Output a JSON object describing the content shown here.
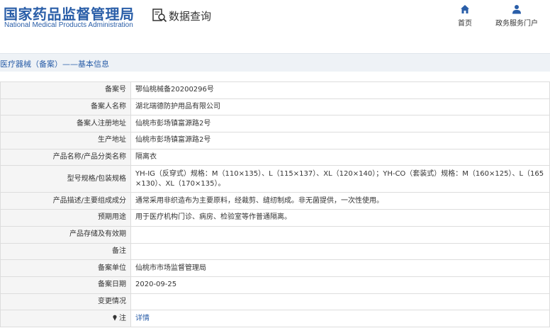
{
  "header": {
    "logo_cn": "国家药品监督管理局",
    "logo_en": "National Medical Products Administration",
    "page_title": "数据查询",
    "nav": [
      {
        "label": "首页",
        "icon": "home-icon"
      },
      {
        "label": "政务服务门户",
        "icon": "user-icon"
      }
    ]
  },
  "section": {
    "title": "医疗器械（备案）——基本信息"
  },
  "rows": [
    {
      "label": "备案号",
      "value": "鄂仙桃械备20200296号"
    },
    {
      "label": "备案人名称",
      "value": "湖北瑞德防护用品有限公司"
    },
    {
      "label": "备案人注册地址",
      "value": "仙桃市彭场镇富源路2号"
    },
    {
      "label": "生产地址",
      "value": "仙桃市彭场镇富源路2号"
    },
    {
      "label": "产品名称/产品分类名称",
      "value": "隔离衣"
    },
    {
      "label": "型号规格/包装规格",
      "value": "YH-IG（反穿式）规格：M（110×135）、L（115×137）、XL（120×140）；YH-CO（套装式）规格：M（160×125）、L（165×130）、XL（170×135）。"
    },
    {
      "label": "产品描述/主要组成成分",
      "value": "通常采用非织造布为主要原料，经裁剪、缝纫制成。非无菌提供，一次性使用。"
    },
    {
      "label": "预期用途",
      "value": "用于医疗机构门诊、病房、检验室等作普通隔离。"
    },
    {
      "label": "产品存储及有效期",
      "value": ""
    },
    {
      "label": "备注",
      "value": ""
    },
    {
      "label": "备案单位",
      "value": "仙桃市市场监督管理局"
    },
    {
      "label": "备案日期",
      "value": "2020-09-25"
    },
    {
      "label": "变更情况",
      "value": ""
    },
    {
      "label": "注",
      "value": "详情"
    }
  ],
  "colors": {
    "brand_blue": "#2a5ea8",
    "label_bg": "#f5f5f5",
    "section_bg": "#eef2f6",
    "border": "#dddddd"
  }
}
